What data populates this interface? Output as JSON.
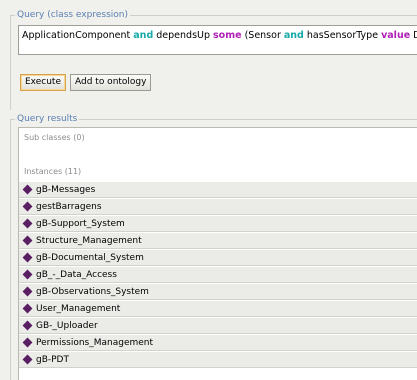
{
  "query": {
    "legend": "Query (class expression)",
    "expression": [
      {
        "text": "ApplicationComponent ",
        "kind": "plain"
      },
      {
        "text": "and",
        "kind": "and"
      },
      {
        "text": " dependsUp ",
        "kind": "plain"
      },
      {
        "text": "some",
        "kind": "some"
      },
      {
        "text": " (Sensor ",
        "kind": "plain"
      },
      {
        "text": "and",
        "kind": "and"
      },
      {
        "text": " hasSensorType ",
        "kind": "plain"
      },
      {
        "text": "value",
        "kind": "value"
      },
      {
        "text": " Drain)",
        "kind": "plain"
      }
    ],
    "execute_label": "Execute",
    "add_label": "Add to ontology"
  },
  "results": {
    "legend": "Query results",
    "subclasses_label": "Sub classes (0)",
    "instances_label": "Instances (11)",
    "instances": [
      "gB-Messages",
      "gestBarragens",
      "gB-Support_System",
      "Structure_Management",
      "gB-Documental_System",
      "gB_-_Data_Access",
      "gB-Observations_System",
      "User_Management",
      "GB-_Uploader",
      "Permissions_Management",
      "gB-PDT"
    ]
  },
  "colors": {
    "keyword_and": "#17a9a9",
    "keyword_some_value": "#b01fb8",
    "legend": "#5b7fb0",
    "individual_icon": "#5a1e62"
  },
  "icons": {
    "individual": "diamond-icon"
  }
}
